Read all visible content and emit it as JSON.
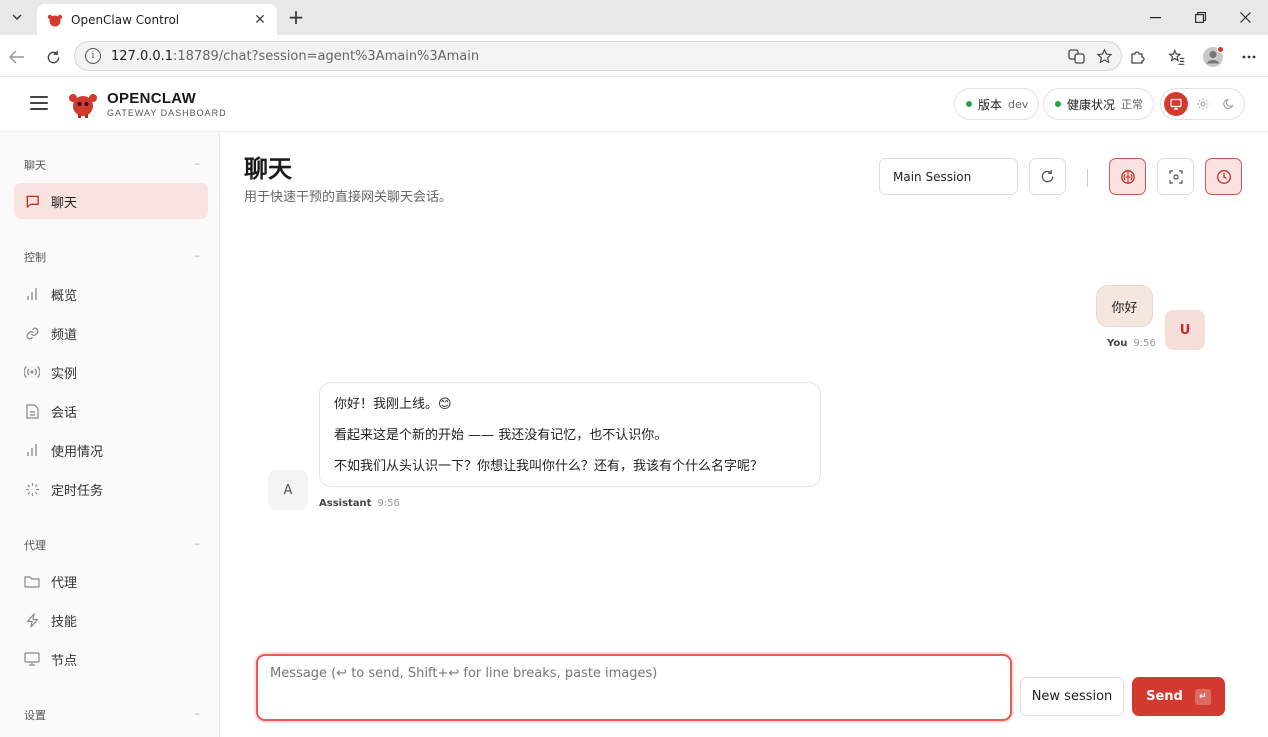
{
  "browser": {
    "tab_title": "OpenClaw Control",
    "url_host": "127.0.0.1",
    "url_rest": ":18789/chat?session=agent%3Amain%3Amain"
  },
  "header": {
    "brand_name": "OPENCLAW",
    "brand_sub": "GATEWAY DASHBOARD",
    "version_label": "版本",
    "version_value": "dev",
    "health_label": "健康状况",
    "health_value": "正常"
  },
  "sidebar": {
    "sections": [
      {
        "title": "聊天",
        "items": [
          {
            "label": "聊天",
            "icon": "message-icon",
            "active": true
          }
        ]
      },
      {
        "title": "控制",
        "items": [
          {
            "label": "概览",
            "icon": "bar-chart-icon"
          },
          {
            "label": "频道",
            "icon": "link-icon"
          },
          {
            "label": "实例",
            "icon": "broadcast-icon"
          },
          {
            "label": "会话",
            "icon": "document-icon"
          },
          {
            "label": "使用情况",
            "icon": "bar-chart-icon"
          },
          {
            "label": "定时任务",
            "icon": "loader-icon"
          }
        ]
      },
      {
        "title": "代理",
        "items": [
          {
            "label": "代理",
            "icon": "folder-icon"
          },
          {
            "label": "技能",
            "icon": "bolt-icon"
          },
          {
            "label": "节点",
            "icon": "monitor-icon"
          }
        ]
      },
      {
        "title": "设置",
        "items": []
      }
    ]
  },
  "main": {
    "title": "聊天",
    "subtitle": "用于快速干预的直接网关聊天会话。",
    "session_select": "Main Session"
  },
  "chat": {
    "user_message": "你好",
    "user_avatar": "U",
    "user_name": "You",
    "user_time": "9:56",
    "assistant_lines": [
      "你好！我刚上线。😊",
      "看起来这是个新的开始 —— 我还没有记忆，也不认识你。",
      "不如我们从头认识一下？你想让我叫你什么？还有，我该有个什么名字呢？"
    ],
    "assistant_avatar": "A",
    "assistant_name": "Assistant",
    "assistant_time": "9:56"
  },
  "composer": {
    "placeholder": "Message (↩ to send, Shift+↩ for line breaks, paste images)",
    "new_session_label": "New session",
    "send_label": "Send"
  },
  "colors": {
    "accent": "#d33a2f",
    "accent_soft": "#f8e3e0",
    "status_ok": "#22a447"
  }
}
